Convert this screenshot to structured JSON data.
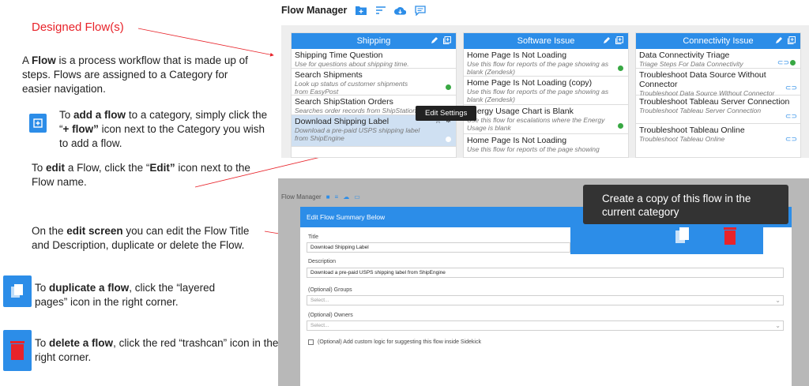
{
  "annotations": {
    "title": "Designed Flow(s)",
    "p1_a": "A",
    "p1_b": "Flow",
    "p1_c": "is a process workflow that is made up of steps.  Flows are assigned to a Category for easier navigation.",
    "p2_a": "To",
    "p2_b": "add a flow",
    "p2_c": "to a category, simply click the “",
    "p2_d": "+ flow”",
    "p2_e": "icon next to the Category you wish to add a flow.",
    "p3_a": "To",
    "p3_b": "edit",
    "p3_c": "a Flow, click the “",
    "p3_d": "Edit”",
    "p3_e": "icon next to the Flow name.",
    "p4_a": "On the",
    "p4_b": "edit screen",
    "p4_c": "you can edit the Flow Title and Description, duplicate or delete the Flow.",
    "p5_a": "To",
    "p5_b": "duplicate a flow",
    "p5_c": ", click the “layered pages” icon in the right corner.",
    "p6_a": "To",
    "p6_b": "delete a flow",
    "p6_c": ", click the red “trashcan” icon in the right corner."
  },
  "flow_manager": {
    "title": "Flow Manager",
    "columns": [
      {
        "name": "Shipping",
        "items": [
          {
            "title": "Shipping Time Question",
            "desc": "Use for questions about shipping time."
          },
          {
            "title": "Search Shipments",
            "desc": "Look up status of customer shipments from EasyPost"
          },
          {
            "title": "Search ShipStation Orders",
            "desc": "Searches order records from ShipStation"
          },
          {
            "title": "Download Shipping Label",
            "desc": "Download a pre-paid USPS shipping label from ShipEngine"
          }
        ]
      },
      {
        "name": "Software Issue",
        "items": [
          {
            "title": "Home Page Is Not Loading",
            "desc": "Use this flow for reports of the page showing as blank (Zendesk)"
          },
          {
            "title": "Home Page Is Not Loading (copy)",
            "desc": "Use this flow for reports of the page showing as blank (Zendesk)"
          },
          {
            "title": "Energy Usage Chart is Blank",
            "desc": "Use this flow for escalations where the Energy Usage is blank"
          },
          {
            "title": "Home Page Is Not Loading",
            "desc": "Use this flow for reports of the page showing"
          }
        ]
      },
      {
        "name": "Connectivity Issue",
        "items": [
          {
            "title": "Data Connectivity Triage",
            "desc": "Triage Steps For Data Connectivity"
          },
          {
            "title": "Troubleshoot Data Source Without Connector",
            "desc": "Troubleshoot Data Source Without Connector"
          },
          {
            "title": "Troubleshoot Tableau Server Connection",
            "desc": "Troubleshoot Tableau Server Connection"
          },
          {
            "title": "Troubleshoot Tableau Online",
            "desc": "Troubleshoot Tableau Online"
          }
        ]
      }
    ],
    "edit_tooltip": "Edit Settings"
  },
  "edit_modal": {
    "fm_title": "Flow Manager",
    "header": "Edit Flow Summary Below",
    "title_label": "Title",
    "title_value": "Download Shipping Label",
    "desc_label": "Description",
    "desc_value": "Download a pre-paid USPS shipping label from ShipEngine",
    "groups_label": "(Optional) Groups",
    "groups_placeholder": "Select...",
    "owners_label": "(Optional) Owners",
    "owners_placeholder": "Select...",
    "custom_logic_label": "(Optional) Add custom logic for suggesting this flow inside Sidekick",
    "copy_tooltip": "Create a copy of this flow in the current category"
  },
  "colors": {
    "accent": "#2c8de8",
    "red": "#e8232a",
    "green": "#38a843"
  },
  "icons": [
    "add-flow-icon",
    "sort-icon",
    "cloud-download-icon",
    "comment-icon",
    "edit-icon",
    "copy-icon",
    "trash-icon",
    "star-icon",
    "gear-icon",
    "link-icon"
  ]
}
